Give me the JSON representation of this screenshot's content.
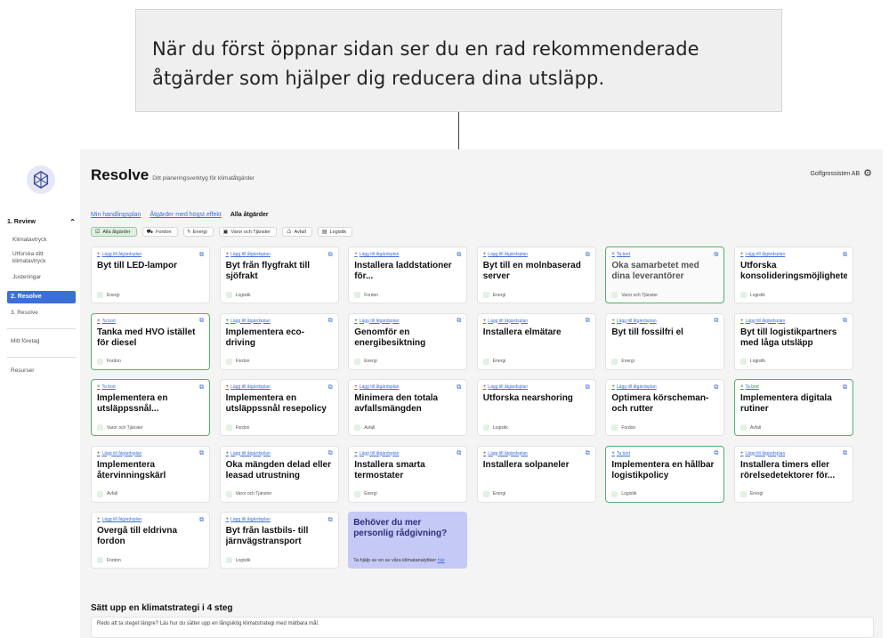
{
  "callout": {
    "text": "När du först öppnar sidan ser du en rad rekommenderade åtgärder som hjälper dig reducera dina utsläpp."
  },
  "sidebar": {
    "section_title": "1. Review",
    "items": [
      "Klimatavtryck",
      "Utforska ditt klimatavtryck",
      "Justeringar"
    ],
    "active": "2. Resolve",
    "next": "3. Resolve",
    "company_link": "Mitt företag",
    "resources": "Resurser"
  },
  "header": {
    "title": "Resolve",
    "subtitle": "Ditt planeringsverktyg för klimatåtgärder",
    "company": "Golfgrossisten AB"
  },
  "tabs": [
    "Min handlingsplan",
    "Åtgärder med högst effekt",
    "Alla åtgärder"
  ],
  "filters": [
    "Alla åtgärder",
    "Fordon",
    "Energi",
    "Varor och Tjänster",
    "Avfall",
    "Logistik"
  ],
  "labels": {
    "add": "Lägg till åtgärdsplan",
    "remove": "Ta bort"
  },
  "cards": [
    {
      "title": "Byt till LED-lampor",
      "category": "Energi",
      "state": "add"
    },
    {
      "title": "Byt från flygfrakt till sjöfrakt",
      "category": "Logistik",
      "state": "add"
    },
    {
      "title": "Installera laddstationer för...",
      "category": "Fordon",
      "state": "add"
    },
    {
      "title": "Byt till en molnbaserad server",
      "category": "Energi",
      "state": "add"
    },
    {
      "title": "Öka samarbetet med dina leverantörer",
      "category": "Varor och Tjänster",
      "state": "remove"
    },
    {
      "title": "Utforska konsolideringsmöjligheter",
      "category": "Logistik",
      "state": "add"
    },
    {
      "title": "Tanka med HVO istället för diesel",
      "category": "Fordon",
      "state": "remove"
    },
    {
      "title": "Implementera eco-driving",
      "category": "Fordon",
      "state": "add"
    },
    {
      "title": "Genomför en energibesiktning",
      "category": "Energi",
      "state": "add"
    },
    {
      "title": "Installera elmätare",
      "category": "Energi",
      "state": "add"
    },
    {
      "title": "Byt till fossilfri el",
      "category": "Energi",
      "state": "add"
    },
    {
      "title": "Byt till logistikpartners med låga utsläpp",
      "category": "Logistik",
      "state": "add"
    },
    {
      "title": "Implementera en utsläppssnål...",
      "category": "Varor och Tjänster",
      "state": "remove"
    },
    {
      "title": "Implementera en utsläppssnål resepolicy",
      "category": "Fordon",
      "state": "add"
    },
    {
      "title": "Minimera den totala avfallsmängden",
      "category": "Avfall",
      "state": "add"
    },
    {
      "title": "Utforska nearshoring",
      "category": "Logistik",
      "state": "add"
    },
    {
      "title": "Optimera körscheman- och rutter",
      "category": "Fordon",
      "state": "add"
    },
    {
      "title": "Implementera digitala rutiner",
      "category": "Avfall",
      "state": "remove"
    },
    {
      "title": "Implementera återvinningskärl",
      "category": "Avfall",
      "state": "add"
    },
    {
      "title": "Öka mängden delad eller leasad utrustning",
      "category": "Varor och Tjänster",
      "state": "add"
    },
    {
      "title": "Installera smarta termostater",
      "category": "Energi",
      "state": "add"
    },
    {
      "title": "Installera solpaneler",
      "category": "Energi",
      "state": "add"
    },
    {
      "title": "Implementera en hållbar logistikpolicy",
      "category": "Logistik",
      "state": "remove"
    },
    {
      "title": "Installera timers eller rörelsedetektorer för...",
      "category": "Energi",
      "state": "add"
    },
    {
      "title": "Övergå till eldrivna fordon",
      "category": "Fordon",
      "state": "add"
    },
    {
      "title": "Byt från lastbils- till järnvägstransport",
      "category": "Logistik",
      "state": "add"
    }
  ],
  "promo": {
    "title": "Behöver du mer personlig rådgivning?",
    "text": "Ta hjälp av en av våra klimatanalytiker",
    "link": "här"
  },
  "strategy": {
    "title": "Sätt upp en klimatstrategi i 4 steg",
    "text": "Redo att ta steget längre? Läs hur du sätter upp en långsiktig klimatstrategi med mätbara mål."
  },
  "colors": {
    "accent": "#3a6fd8",
    "remove_border": "#4fb36a",
    "promo_bg": "#c5c9f5"
  }
}
